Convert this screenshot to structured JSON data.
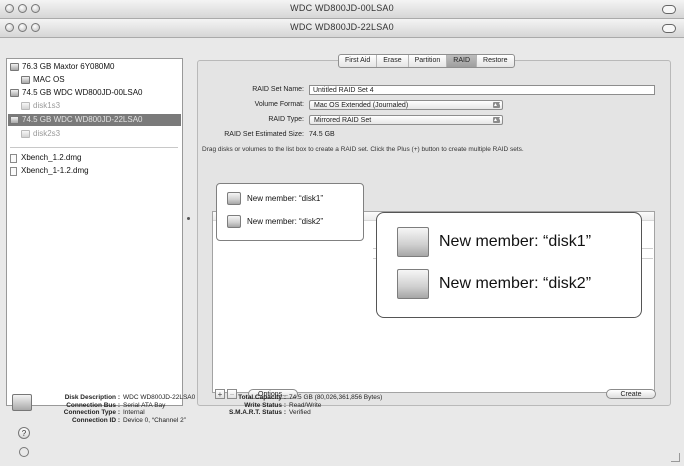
{
  "windows": {
    "back_title": "WDC WD800JD-00LSA0",
    "front_title": "WDC WD800JD-22LSA0"
  },
  "sidebar": {
    "items": [
      {
        "label": "76.3 GB Maxtor 6Y080M0",
        "type": "disk"
      },
      {
        "label": "MAC OS",
        "type": "volume"
      },
      {
        "label": "74.5 GB WDC WD800JD-00LSA0",
        "type": "disk"
      },
      {
        "label": "disk1s3",
        "type": "volume-dim"
      },
      {
        "label": "74.5 GB WDC WD800JD-22LSA0",
        "type": "disk-selected"
      },
      {
        "label": "disk2s3",
        "type": "volume-dim"
      },
      {
        "label": "Xbench_1.2.dmg",
        "type": "image"
      },
      {
        "label": "Xbench_1-1.2.dmg",
        "type": "image"
      }
    ]
  },
  "tabs": [
    {
      "label": "First Aid",
      "active": false
    },
    {
      "label": "Erase",
      "active": false
    },
    {
      "label": "Partition",
      "active": false
    },
    {
      "label": "RAID",
      "active": true
    },
    {
      "label": "Restore",
      "active": false
    }
  ],
  "raid": {
    "set_name_label": "RAID Set Name:",
    "set_name_value": "Untitled RAID Set 4",
    "volume_format_label": "Volume Format:",
    "volume_format_value": "Mac OS Extended (Journaled)",
    "raid_type_label": "RAID Type:",
    "raid_type_value": "Mirrored RAID Set",
    "estimated_size_label": "RAID Set Estimated Size:",
    "estimated_size_value": "74.5 GB",
    "instructions": "Drag disks or volumes to the list box to create a RAID set. Click the Plus (+) button to create multiple RAID sets.",
    "members": [
      "New member: “disk1”",
      "New member: “disk2”"
    ],
    "plus_label": "+",
    "minus_label": "−",
    "options_label": "Options...",
    "create_label": "Create"
  },
  "info": {
    "disk_description_label": "Disk Description :",
    "disk_description_value": "WDC WD800JD-22LSA0",
    "connection_bus_label": "Connection Bus :",
    "connection_bus_value": "Serial ATA Bay",
    "connection_type_label": "Connection Type :",
    "connection_type_value": "Internal",
    "connection_id_label": "Connection ID :",
    "connection_id_value": "Device 0, “Channel 2”",
    "total_capacity_label": "Total Capacity :",
    "total_capacity_value": "74.5 GB (80,026,361,856 Bytes)",
    "write_status_label": "Write Status :",
    "write_status_value": "Read/Write",
    "smart_status_label": "S.M.A.R.T. Status :",
    "smart_status_value": "Verified",
    "help_label": "?"
  },
  "colors": {
    "selection": "#7a7a7a",
    "window_bg": "#e9e9e9"
  }
}
